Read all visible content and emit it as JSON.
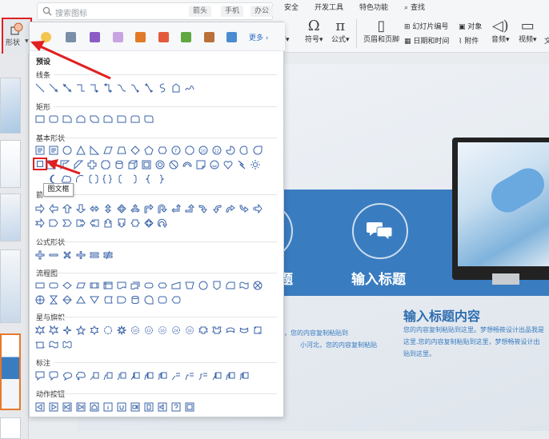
{
  "ribbon": {
    "tabs": [
      "安全",
      "开发工具",
      "特色功能",
      "查找"
    ],
    "shape_button_label": "形状",
    "buttons": {
      "symbol": "符号",
      "formula": "公式",
      "text_partial": "字",
      "header_footer": "页眉和页脚",
      "slide_number": "幻灯片编号",
      "object": "对象",
      "date_time": "日期和时间",
      "attachment": "附件",
      "audio": "音频",
      "video": "视频",
      "extra": "文"
    }
  },
  "search": {
    "placeholder": "搜索图标",
    "tags": [
      "箭头",
      "手机",
      "办公"
    ]
  },
  "panel": {
    "more_label": "更多",
    "preset_label": "预设",
    "sections": {
      "lines": "线条",
      "rectangle": "矩形",
      "basic": "基本形状",
      "arrows_partial": "箭",
      "formula": "公式形状",
      "flowchart": "流程图",
      "stars": "星与旗帜",
      "callouts": "标注",
      "actions": "动作按钮"
    },
    "tooltip": "图文框",
    "selected_shape": "frame-shape"
  },
  "slide": {
    "band_title_1_partial": "题",
    "band_title_2": "输入标题",
    "heading": "输入标题内容",
    "body_left_1": "，您的内容复制粘贴到",
    "body_left_2": "小河北，您的内容复制粘贴",
    "body_right_1": "您的内容复制粘贴到这里。梦想畅筱设计出品我是",
    "body_right_2": "这里.您的内容复制粘贴到这里，梦想畅筱设计出",
    "body_right_3": "贴到这里。"
  },
  "colors": {
    "highlight": "#e02020",
    "accent_blue": "#3a7cc0",
    "link_blue": "#2c6ec5"
  }
}
